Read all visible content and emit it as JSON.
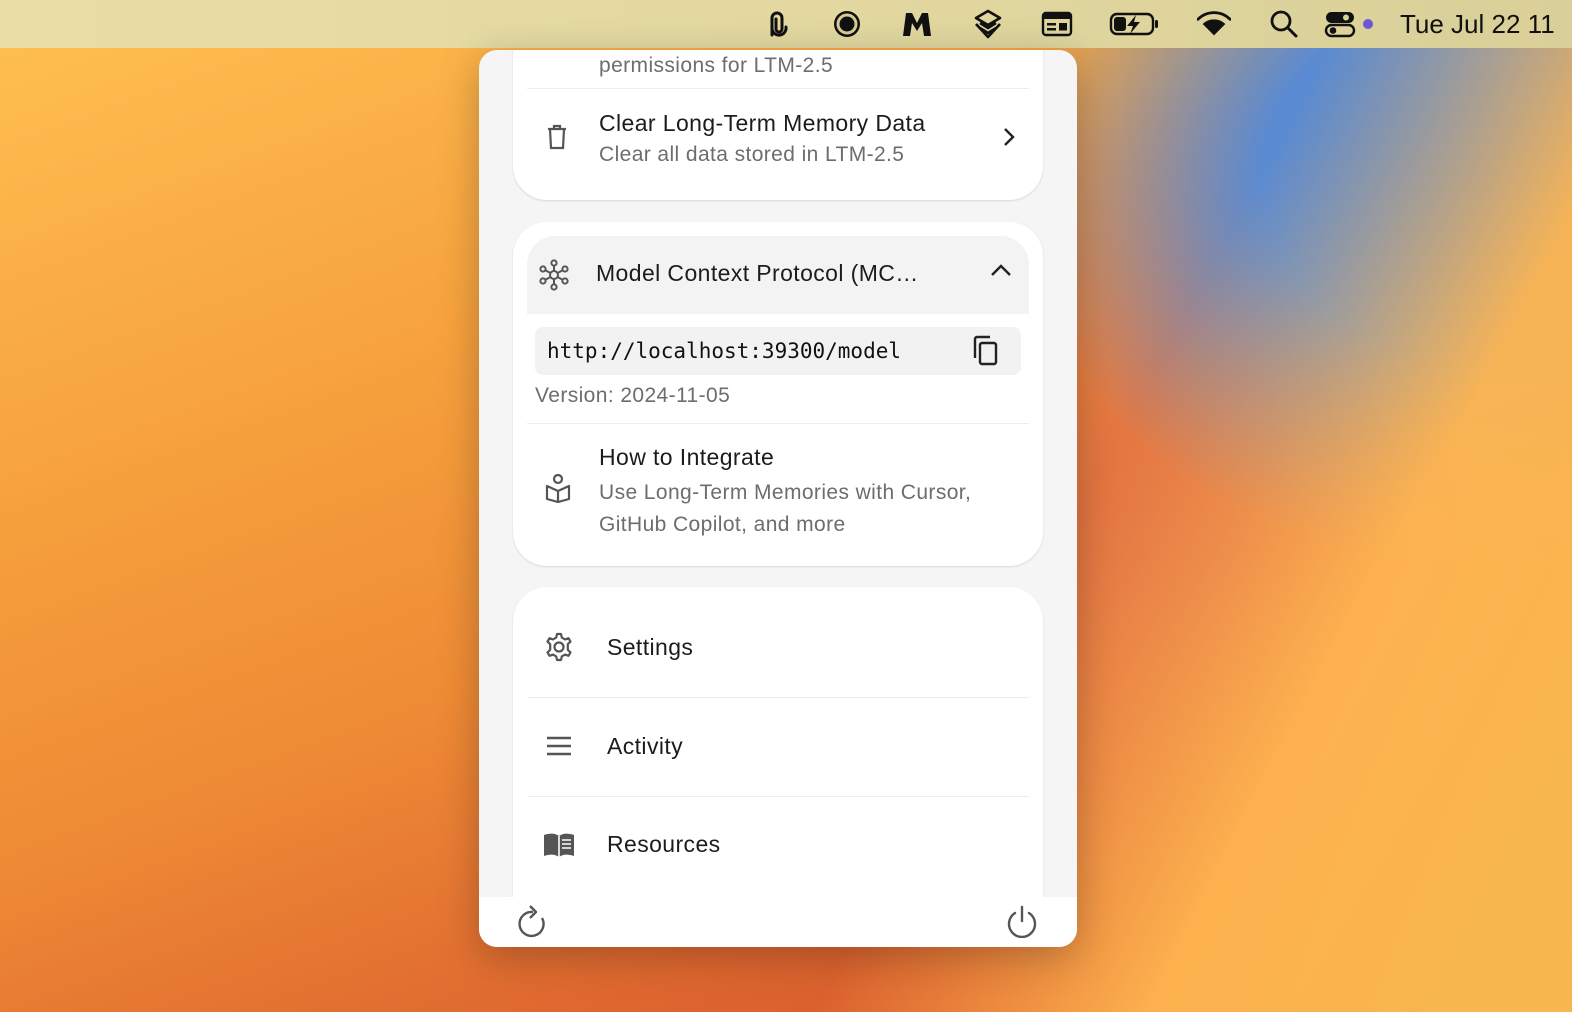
{
  "menubar": {
    "icons": [
      "paperclip-app-icon",
      "circle-app-icon",
      "m-app-icon",
      "layers-app-icon",
      "keyboard-app-icon",
      "battery-charging-icon",
      "wifi-icon",
      "search-icon",
      "control-center-icon"
    ],
    "clock": "Tue Jul 22  11"
  },
  "panel": {
    "permissions_partial": "permissions for LTM-2.5",
    "clear_memory": {
      "title": "Clear Long-Term Memory Data",
      "subtitle": "Clear all data stored in LTM-2.5"
    },
    "mcp": {
      "title": "Model Context Protocol (MC…",
      "url": "http://localhost:39300/model",
      "version": "Version: 2024-11-05"
    },
    "integrate": {
      "title": "How to Integrate",
      "subtitle": "Use Long-Term Memories with Cursor, GitHub Copilot, and more"
    },
    "menu": [
      {
        "label": "Settings",
        "icon": "gear-icon"
      },
      {
        "label": "Activity",
        "icon": "menu-lines-icon"
      },
      {
        "label": "Resources",
        "icon": "book-icon"
      }
    ],
    "footer": {
      "refresh_icon": "refresh-icon",
      "power_icon": "power-icon"
    }
  },
  "colors": {
    "panel_bg": "#f5f5f5",
    "card_bg": "#ffffff",
    "text_primary": "#1c1c1c",
    "text_secondary": "#6d6d6d",
    "icon_gray": "#555555"
  }
}
